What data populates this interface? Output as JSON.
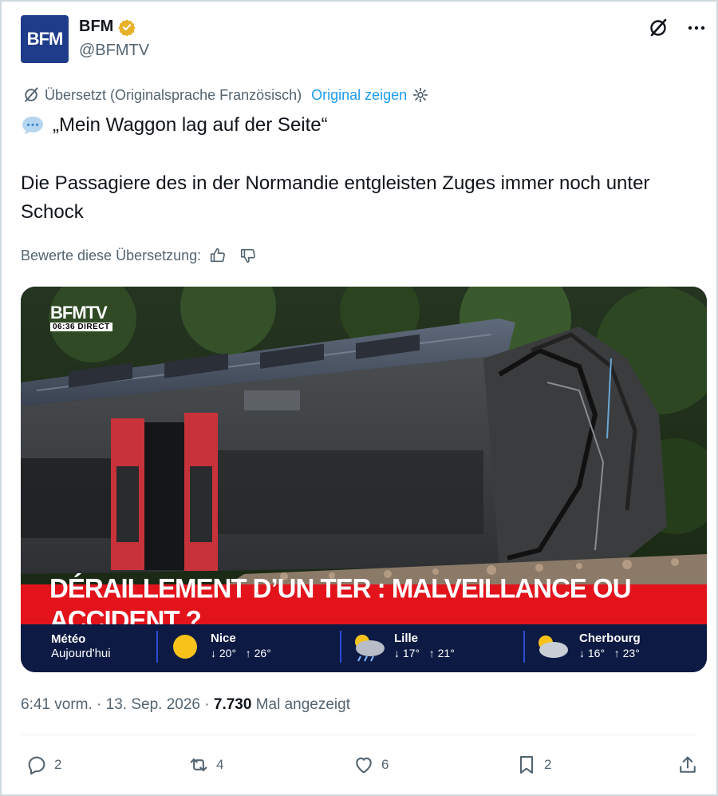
{
  "author": {
    "avatar_text": "BFM",
    "name": "BFM",
    "handle": "@BFMTV"
  },
  "translation": {
    "label": "Übersetzt (Originalsprache Französisch)",
    "show_original": "Original zeigen"
  },
  "tweet": {
    "line1": "„Mein Waggon lag auf der Seite“",
    "line2": "Die Passagiere des in der Normandie entgleisten Zuges immer noch unter Schock"
  },
  "rating": {
    "label": "Bewerte diese Übersetzung:"
  },
  "media": {
    "channel_logo": "BFMTV",
    "channel_time": "06:36 DIRECT",
    "headline": "DÉRAILLEMENT D’UN TER : MALVEILLANCE OU ACCIDENT ?",
    "weather": {
      "title": "Météo",
      "subtitle": "Aujourd'hui",
      "cities": [
        {
          "city": "Nice",
          "low": "↓ 20°",
          "high": "↑ 26°",
          "icon": "sun-icon"
        },
        {
          "city": "Lille",
          "low": "↓ 17°",
          "high": "↑ 21°",
          "icon": "rain-cloud-icon"
        },
        {
          "city": "Cherbourg",
          "low": "↓ 16°",
          "high": "↑ 23°",
          "icon": "partly-cloudy-icon"
        }
      ]
    }
  },
  "meta": {
    "time": "6:41 vorm.",
    "date": "13. Sep. 2026",
    "views": "7.730",
    "views_label": "Mal angezeigt"
  },
  "actions": {
    "replies": "2",
    "reposts": "4",
    "likes": "6",
    "bookmarks": "2"
  },
  "colors": {
    "link": "#1d9bf0",
    "muted": "#536471",
    "banner_red": "#e3131c",
    "weather_bg": "#0d1a44"
  }
}
